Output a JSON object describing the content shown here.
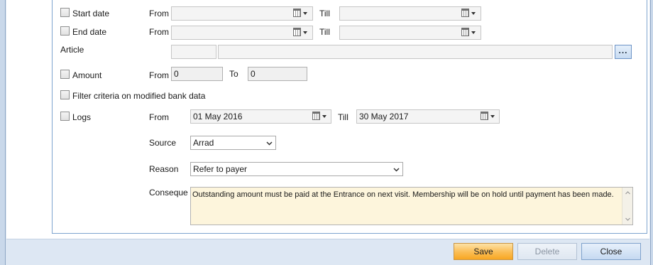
{
  "filters": {
    "start_date": {
      "checkbox_label": "Start date",
      "from_label": "From",
      "from_value": "",
      "till_label": "Till",
      "till_value": ""
    },
    "end_date": {
      "checkbox_label": "End date",
      "from_label": "From",
      "from_value": "",
      "till_label": "Till",
      "till_value": ""
    },
    "article": {
      "label": "Article",
      "code_value": "",
      "name_value": "",
      "browse_label": "..."
    },
    "amount": {
      "checkbox_label": "Amount",
      "from_label": "From",
      "from_value": "0",
      "to_label": "To",
      "to_value": "0"
    },
    "modified_bank_data": {
      "checkbox_label": "Filter criteria on modified bank data"
    },
    "logs": {
      "checkbox_label": "Logs",
      "from_label": "From",
      "from_value": "01 May 2016",
      "till_label": "Till",
      "till_value": "30 May 2017",
      "source_label": "Source",
      "source_value": "Arrad",
      "reason_label": "Reason",
      "reason_value": "Refer to payer",
      "consequence_label": "Conseque",
      "consequence_value": "Outstanding amount must be paid at the Entrance on next visit. Membership will be on hold until payment has been made."
    }
  },
  "buttons": {
    "save": "Save",
    "delete": "Delete",
    "close": "Close"
  },
  "colors": {
    "save_button": "#fbbf5a",
    "memo_background": "#fdf5dc",
    "group_border": "#7ea4cf"
  }
}
